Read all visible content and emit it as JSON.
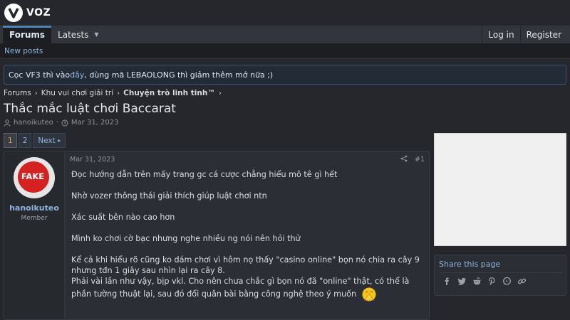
{
  "brand": {
    "logo_text": "VOZ"
  },
  "nav": {
    "tabs": [
      {
        "label": "Forums"
      },
      {
        "label": "Latests"
      }
    ],
    "login": "Log in",
    "register": "Register"
  },
  "subnav": {
    "new_posts": "New posts"
  },
  "notice": {
    "pre": "Cọc VF3 thì vào ",
    "link": "đây",
    "post": ", dùng mã LEBAOLONG thì giảm thêm mớ nữa ;)"
  },
  "breadcrumb": [
    "Forums",
    "Khu vui chơi giải trí",
    "Chuyện trò linh tinh™"
  ],
  "thread": {
    "title": "Thắc mắc luật chơi Baccarat",
    "author": "hanoikuteo",
    "date": "Mar 31, 2023"
  },
  "pagination": {
    "pages": [
      "1",
      "2"
    ],
    "next": "Next"
  },
  "post": {
    "avatar_text": "FAKE",
    "username": "hanoikuteo",
    "user_title": "Member",
    "date": "Mar 31, 2023",
    "number": "#1",
    "paragraphs": [
      "Đọc hướng dẫn trên mấy trang gc cá cược chẳng hiểu mô tê gì hết",
      "Nhờ vozer thông thái giải thích giúp luật chơi ntn",
      "Xác suất bên nào cao hơn",
      "Mình ko chơi cờ bạc nhưng nghe nhiều ng nói nên hỏi thử",
      "Kể cả khi hiểu rõ cũng ko dám chơi vì hôm nọ thấy \"casino online\" bọn nó chia ra cây 9 nhưng tđn 1 giây sau nhìn lại ra cây 8.",
      "Phải vài lần như vậy, bịp vkl. Cho nên chưa chắc gì bọn nó đã \"online\" thật, có thể là phần tường thuật lại, sau đó đổi quân bài bằng công nghệ theo ý muốn"
    ]
  },
  "sidebar": {
    "share_title": "Share this page"
  },
  "icons": [
    "logo-icon",
    "caret-down-icon",
    "chevron-right-icon",
    "user-icon",
    "clock-icon",
    "share-icon",
    "facebook-icon",
    "twitter-icon",
    "reddit-icon",
    "pinterest-icon",
    "whatsapp-icon",
    "link-icon",
    "pray-emoji-icon"
  ],
  "colors": {
    "accent": "#8eb4df",
    "background": "#25272c",
    "nav_active_border": "#4f85bf"
  }
}
